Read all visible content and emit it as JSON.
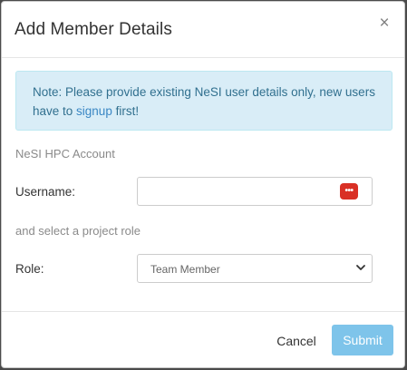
{
  "modal": {
    "title": "Add Member Details",
    "close_glyph": "×"
  },
  "alert": {
    "text_before": "Note: Please provide existing NeSI user details only, new users have to ",
    "link_text": "signup",
    "text_after": " first!"
  },
  "form": {
    "account_section_label": "NeSI HPC Account",
    "username_label": "Username:",
    "username_value": "",
    "role_section_label": "and select a project role",
    "role_label": "Role:",
    "role_selected": "Team Member"
  },
  "footer": {
    "cancel_label": "Cancel",
    "submit_label": "Submit"
  },
  "icons": {
    "close": "close-icon",
    "password_manager": "password-manager-icon",
    "chevron": "chevron-down-icon"
  },
  "colors": {
    "alert_background": "#d9edf7",
    "alert_text": "#31708f",
    "link": "#3a87c4",
    "submit_background": "#7ec4ea",
    "password_icon": "#d93025"
  }
}
